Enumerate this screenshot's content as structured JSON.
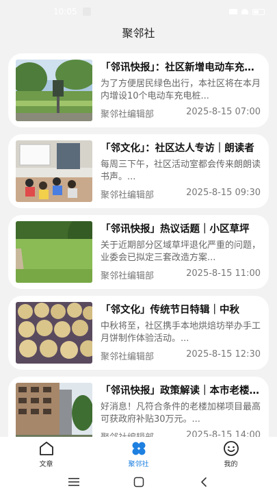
{
  "status_bar": {
    "time": "10:05",
    "icons": [
      "app-notification-icon",
      "signal-icon",
      "wifi-icon",
      "battery-icon"
    ]
  },
  "header": {
    "title": "聚邻社"
  },
  "articles": [
    {
      "title": "「邻讯快报」：社区新增电动车充电桩",
      "summary": "为了方便居民绿色出行，本社区将在本月内增设10个电动车充电桩...",
      "author": "聚邻社编辑部",
      "time": "2025-8-15 07:00",
      "thumbnail": "ev-charging-station-photo"
    },
    {
      "title": "「邻文化」：社区达人专访｜朗读者",
      "summary": "每周三下午，社区活动室都会传来朗朗读书声。...",
      "author": "聚邻社编辑部",
      "time": "2025-8-15 09:30",
      "thumbnail": "classroom-reading-photo"
    },
    {
      "title": "「邻讯快报」热议话题｜小区草坪",
      "summary": "关于近期部分区域草坪退化严重的问题，业委会已拟定三套改造方案...",
      "author": "聚邻社编辑部",
      "time": "2025-8-15 11:00",
      "thumbnail": "lawn-photo"
    },
    {
      "title": "「邻文化」传统节日特辑｜中秋",
      "summary": "中秋将至，社区携手本地烘焙坊举办手工月饼制作体验活动。...",
      "author": "聚邻社编辑部",
      "time": "2025-8-15 12:30",
      "thumbnail": "mooncakes-photo"
    },
    {
      "title": "「邻讯快报」政策解读｜本市老楼加梯",
      "summary": "好消息！凡符合条件的老楼加梯项目最高可获政府补贴30万元。...",
      "author": "聚邻社编辑部",
      "time": "2025-8-15 14:00",
      "thumbnail": "apartment-building-photo"
    }
  ],
  "bottom_nav": [
    {
      "label": "文章",
      "icon": "home-icon",
      "active": false
    },
    {
      "label": "聚邻社",
      "icon": "clover-icon",
      "active": true
    },
    {
      "label": "我的",
      "icon": "smiley-icon",
      "active": false
    }
  ],
  "system_nav": [
    "menu-icon",
    "home-square-icon",
    "back-icon"
  ],
  "colors": {
    "accent": "#1e80e0",
    "background": "#f2f2f2",
    "card": "#ffffff"
  }
}
